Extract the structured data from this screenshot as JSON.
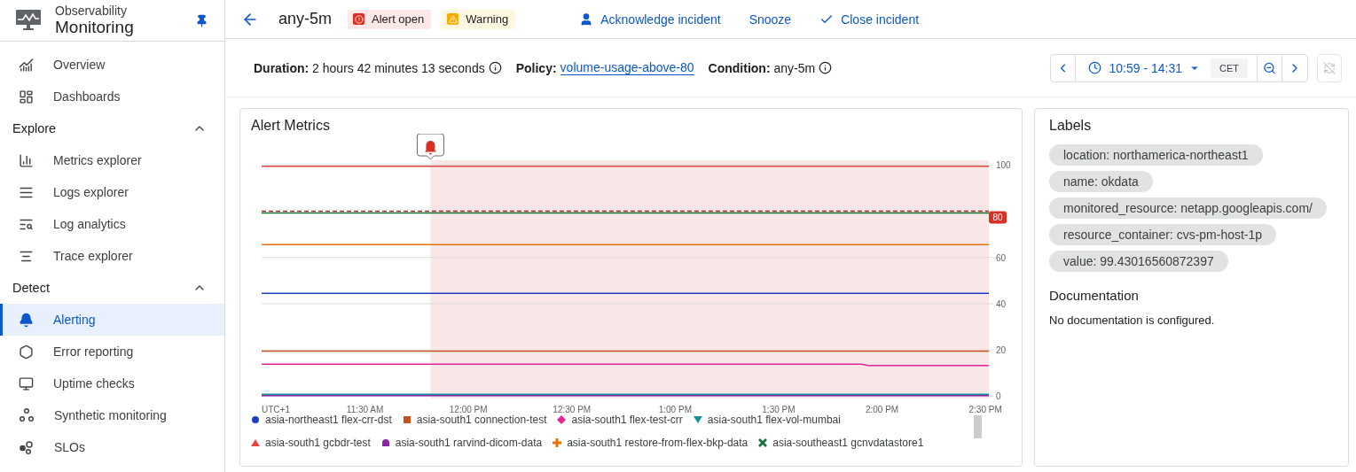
{
  "app": {
    "product": "Observability",
    "title": "Monitoring",
    "pinned": true
  },
  "nav": {
    "items": [
      {
        "label": "Overview",
        "selected": false
      },
      {
        "label": "Dashboards",
        "selected": false
      }
    ],
    "sections": [
      {
        "title": "Explore",
        "expanded": true,
        "items": [
          {
            "label": "Metrics explorer",
            "selected": false
          },
          {
            "label": "Logs explorer",
            "selected": false
          },
          {
            "label": "Log analytics",
            "selected": false
          },
          {
            "label": "Trace explorer",
            "selected": false
          }
        ]
      },
      {
        "title": "Detect",
        "expanded": true,
        "items": [
          {
            "label": "Alerting",
            "selected": true
          },
          {
            "label": "Error reporting",
            "selected": false
          },
          {
            "label": "Uptime checks",
            "selected": false
          },
          {
            "label": "Synthetic monitoring",
            "selected": false
          },
          {
            "label": "SLOs",
            "selected": false
          }
        ]
      }
    ]
  },
  "incident": {
    "title": "any-5m",
    "badges": [
      {
        "kind": "alert",
        "label": "Alert open"
      },
      {
        "kind": "warning",
        "label": "Warning"
      }
    ],
    "actions": [
      {
        "kind": "acknowledge",
        "label": "Acknowledge incident"
      },
      {
        "kind": "plain",
        "label": "Snooze"
      },
      {
        "kind": "close",
        "label": "Close incident"
      }
    ]
  },
  "details": {
    "duration_label": "Duration:",
    "duration": "2 hours 42 minutes 13 seconds",
    "policy_label": "Policy:",
    "policy": "volume-usage-above-80",
    "condition_label": "Condition:",
    "condition": "any-5m"
  },
  "time_range": {
    "range": "10:59 - 14:31",
    "timezone": "CET",
    "sync_disabled": true
  },
  "chart_card": {
    "title": "Alert Metrics",
    "timezone_label": "UTC+1",
    "alert_marker": true,
    "chart_data": {
      "type": "line",
      "xlim": [
        660,
        871
      ],
      "ylim": [
        -1,
        102
      ],
      "xticks": [
        {
          "value": 690,
          "label": "11:30 AM"
        },
        {
          "value": 720,
          "label": "12:00 PM"
        },
        {
          "value": 750,
          "label": "12:30 PM"
        },
        {
          "value": 780,
          "label": "1:00 PM"
        },
        {
          "value": 810,
          "label": "1:30 PM"
        },
        {
          "value": 840,
          "label": "2:00 PM"
        },
        {
          "value": 870,
          "label": "2:30 PM"
        }
      ],
      "yticks": [
        0,
        20,
        40,
        60,
        100
      ],
      "x": [
        660,
        834,
        836,
        871
      ],
      "series": [
        {
          "name": "asia-northeast1 flex-crr-dst",
          "color": "#1a3fc4",
          "values": [
            44.5,
            44.5,
            44.5,
            44.5
          ]
        },
        {
          "name": "asia-south1 connection-test",
          "color": "#c5521b",
          "values": [
            19.5,
            19.5,
            19.5,
            19.5
          ]
        },
        {
          "name": "asia-south1 flex-test-crr",
          "color": "#e52592",
          "values": [
            13.8,
            13.8,
            13.3,
            13.3
          ]
        },
        {
          "name": "asia-south1 flex-vol-mumbai",
          "color": "#12939a",
          "values": [
            0.8,
            0.8,
            0.8,
            0.8
          ]
        },
        {
          "name": "asia-south1 gcbdr-test",
          "color": "#e8453c",
          "values": [
            99.4,
            99.4,
            99.4,
            99.4
          ]
        },
        {
          "name": "asia-south1 rarvind-dicom-data",
          "color": "#8e24aa",
          "values": [
            0.2,
            0.2,
            0.2,
            0.2
          ]
        },
        {
          "name": "asia-south1 restore-from-flex-bkp-data",
          "color": "#e8710a",
          "values": [
            65.5,
            65.5,
            65.5,
            65.5
          ]
        },
        {
          "name": "asia-southeast1 gcnvdatastore1",
          "color": "#137333",
          "values": [
            79.2,
            79.2,
            79.2,
            79.2
          ]
        }
      ],
      "grid": true,
      "ref_lines": [
        {
          "axis": "y",
          "value": 80,
          "label": "80"
        }
      ],
      "bands": [
        {
          "axis": "x",
          "from": 709,
          "to": 871
        }
      ]
    }
  },
  "labels_card": {
    "title": "Labels",
    "labels": [
      "location: northamerica-northeast1",
      "name: okdata",
      "monitored_resource: netapp.googleapis.com/",
      "resource_container: cvs-pm-host-1p",
      "value: 99.43016560872397"
    ],
    "documentation_title": "Documentation",
    "documentation": "No documentation is configured."
  }
}
